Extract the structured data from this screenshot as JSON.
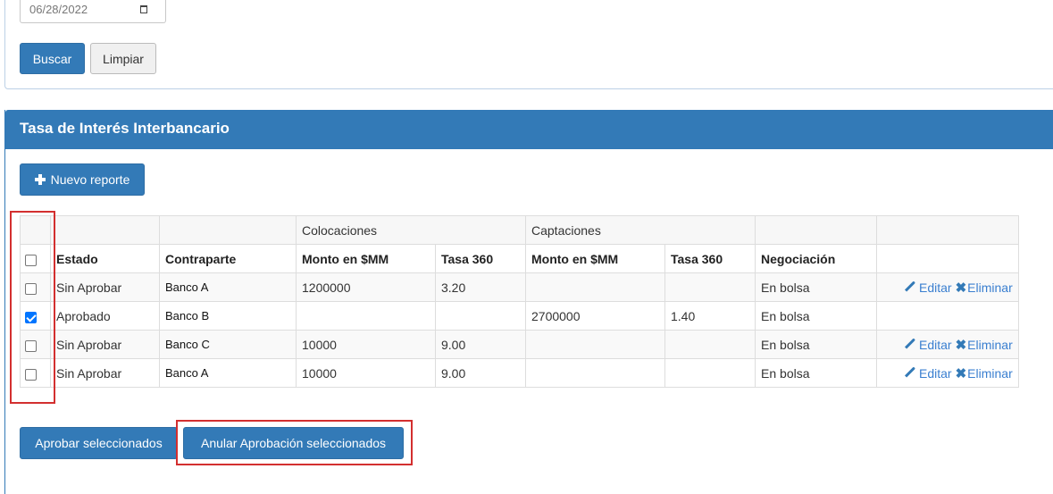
{
  "search": {
    "date_value": "06/28/2022",
    "buscar_label": "Buscar",
    "limpiar_label": "Limpiar"
  },
  "panel": {
    "title": "Tasa de Interés Interbancario",
    "new_report_label": "Nuevo reporte"
  },
  "table": {
    "group_headers": [
      "Colocaciones",
      "Captaciones"
    ],
    "columns": [
      "Estado",
      "Contraparte",
      "Monto en $MM",
      "Tasa 360",
      "Monto en $MM",
      "Tasa 360",
      "Negociación"
    ],
    "rows": [
      {
        "checked": false,
        "estado": "Sin Aprobar",
        "contraparte": "Banco A",
        "col_monto": "1200000",
        "col_tasa": "3.20",
        "cap_monto": "",
        "cap_tasa": "",
        "negociacion": "En bolsa",
        "editar": "Editar",
        "eliminar": "Eliminar"
      },
      {
        "checked": true,
        "estado": "Aprobado",
        "contraparte": "Banco B",
        "col_monto": "",
        "col_tasa": "",
        "cap_monto": "2700000",
        "cap_tasa": "1.40",
        "negociacion": "En bolsa",
        "editar": "",
        "eliminar": ""
      },
      {
        "checked": false,
        "estado": "Sin Aprobar",
        "contraparte": "Banco C",
        "col_monto": "10000",
        "col_tasa": "9.00",
        "cap_monto": "",
        "cap_tasa": "",
        "negociacion": "En bolsa",
        "editar": "Editar",
        "eliminar": "Eliminar"
      },
      {
        "checked": false,
        "estado": "Sin Aprobar",
        "contraparte": "Banco A",
        "col_monto": "10000",
        "col_tasa": "9.00",
        "cap_monto": "",
        "cap_tasa": "",
        "negociacion": "En bolsa",
        "editar": "Editar",
        "eliminar": "Eliminar"
      }
    ]
  },
  "footer": {
    "approve_label": "Aprobar seleccionados",
    "cancel_approval_label": "Anular Aprobación seleccionados"
  },
  "icons": {
    "calendar": "calendar-icon",
    "plus": "plus-icon",
    "edit": "pencil-icon",
    "delete": "x-icon"
  },
  "colors": {
    "primary": "#337ab7",
    "highlight": "#d32f2f",
    "checkbox_checked": "#0075ff"
  }
}
